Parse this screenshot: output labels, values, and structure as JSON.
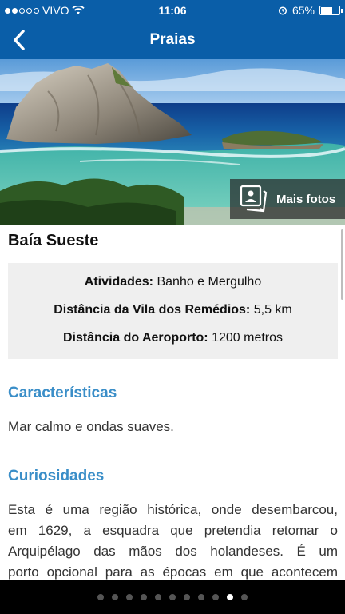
{
  "status": {
    "carrier": "VIVO",
    "time": "11:06",
    "battery": "65%",
    "battery_level": 0.65,
    "signal_bars": 2,
    "signal_total": 5
  },
  "nav": {
    "title": "Praias",
    "back_icon": "chevron-left-icon"
  },
  "hero": {
    "more_photos_label": "Mais fotos",
    "photos_icon": "photos-icon"
  },
  "beach": {
    "name": "Baía Sueste"
  },
  "info": {
    "activities_label": "Atividades:",
    "activities_value": "Banho e Mergulho",
    "village_label": "Distância da Vila dos Remédios:",
    "village_value": "5,5 km",
    "airport_label": "Distância do Aeroporto:",
    "airport_value": "1200 metros"
  },
  "characteristics": {
    "heading": "Características",
    "text": "Mar calmo e ondas suaves."
  },
  "curiosities": {
    "heading": "Curiosidades",
    "lines": [
      "Esta é uma região histórica, onde desembarcou,",
      "em 1629, a esquadra que pretendia retomar o",
      "Arquipélago das mãos dos holandeses. É um",
      "porto opcional para as épocas em que acontecem"
    ]
  },
  "pager": {
    "total": 11,
    "active_index": 9
  },
  "colors": {
    "primary": "#0a5ea8",
    "accent": "#3a8ec8"
  }
}
